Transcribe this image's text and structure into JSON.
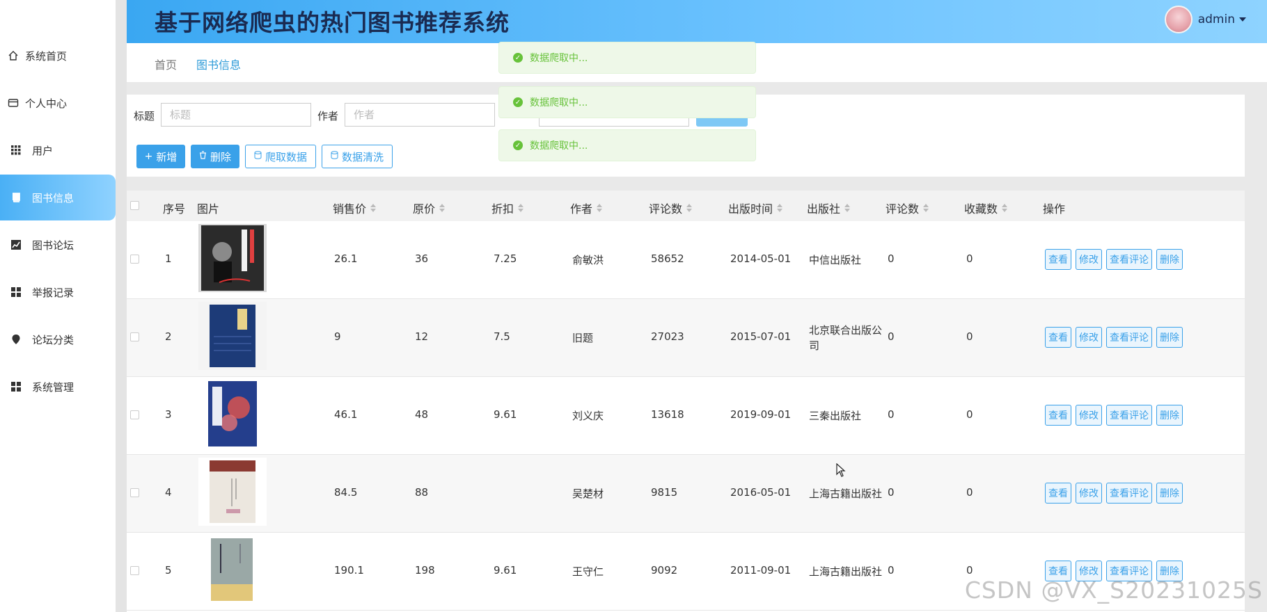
{
  "header": {
    "title": "基于网络爬虫的热门图书推荐系统",
    "user": "admin"
  },
  "sidebar": {
    "items": [
      {
        "label": "系统首页",
        "icon": "home-icon"
      },
      {
        "label": "个人中心",
        "icon": "wallet-icon"
      },
      {
        "label": "用户",
        "icon": "grid-icon"
      },
      {
        "label": "图书信息",
        "icon": "book-icon",
        "active": true
      },
      {
        "label": "图书论坛",
        "icon": "chart-icon"
      },
      {
        "label": "举报记录",
        "icon": "grid-icon"
      },
      {
        "label": "论坛分类",
        "icon": "pin-icon"
      },
      {
        "label": "系统管理",
        "icon": "grid-icon"
      }
    ]
  },
  "breadcrumb": {
    "home": "首页",
    "current": "图书信息"
  },
  "search": {
    "title_label": "标题",
    "title_placeholder": "标题",
    "author_label": "作者",
    "author_placeholder": "作者"
  },
  "actions": {
    "add": "新增",
    "delete": "删除",
    "crawl": "爬取数据",
    "clean": "数据清洗"
  },
  "toasts": [
    "数据爬取中...",
    "数据爬取中...",
    "数据爬取中..."
  ],
  "table": {
    "columns": [
      "序号",
      "图片",
      "销售价",
      "原价",
      "折扣",
      "作者",
      "评论数",
      "出版时间",
      "出版社",
      "评论数",
      "收藏数",
      "操作"
    ],
    "row_actions": [
      "查看",
      "修改",
      "查看评论",
      "删除"
    ],
    "rows": [
      {
        "index": "1",
        "price": "26.1",
        "original": "36",
        "discount": "7.25",
        "author": "俞敏洪",
        "reviews": "58652",
        "date": "2014-05-01",
        "publisher": "中信出版社",
        "comments": "0",
        "favorites": "0",
        "cover_color": "#2b2b2b"
      },
      {
        "index": "2",
        "price": "9",
        "original": "12",
        "discount": "7.5",
        "author": "旧题",
        "reviews": "27023",
        "date": "2015-07-01",
        "publisher": "北京联合出版公司",
        "comments": "0",
        "favorites": "0",
        "cover_color": "#1d3b78"
      },
      {
        "index": "3",
        "price": "46.1",
        "original": "48",
        "discount": "9.61",
        "author": "刘义庆",
        "reviews": "13618",
        "date": "2019-09-01",
        "publisher": "三秦出版社",
        "comments": "0",
        "favorites": "0",
        "cover_color": "#243e8c"
      },
      {
        "index": "4",
        "price": "84.5",
        "original": "88",
        "discount": "",
        "author": "吴楚材",
        "reviews": "9815",
        "date": "2016-05-01",
        "publisher": "上海古籍出版社",
        "comments": "0",
        "favorites": "0",
        "cover_color": "#e8e2d8"
      },
      {
        "index": "5",
        "price": "190.1",
        "original": "198",
        "discount": "9.61",
        "author": "王守仁",
        "reviews": "9092",
        "date": "2011-09-01",
        "publisher": "上海古籍出版社",
        "comments": "0",
        "favorites": "0",
        "cover_color": "#9aa8a6"
      }
    ]
  },
  "watermark": "CSDN @VX_S20231025S",
  "colors": {
    "accent": "#3aa1e9",
    "header_start": "#3aa7f2",
    "success": "#67c23a"
  }
}
